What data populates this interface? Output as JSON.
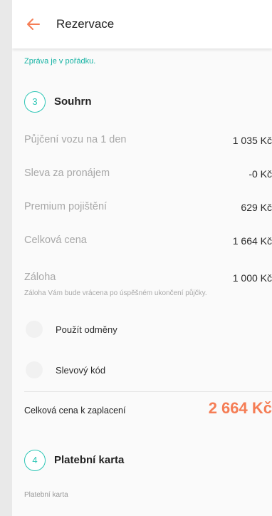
{
  "header": {
    "title": "Rezervace",
    "back_icon": "arrow-left-icon",
    "accent_color": "#f57d55"
  },
  "notice": "Zpráva je v pořádku.",
  "sections": {
    "summary": {
      "step": "3",
      "title": "Souhrn"
    },
    "payment": {
      "step": "4",
      "title": "Platební karta",
      "field_label": "Platební karta"
    }
  },
  "summary_rows": [
    {
      "label": "Půjčení vozu na 1 den",
      "value": "1 035 Kč"
    },
    {
      "label": "Sleva za pronájem",
      "value": "-0 Kč"
    },
    {
      "label": "Premium pojištění",
      "value": "629 Kč"
    },
    {
      "label": "Celková cena",
      "value": "1 664 Kč"
    },
    {
      "label": "Záloha",
      "value": "1 000 Kč",
      "note": "Záloha Vám bude vrácena po úspěšném ukončení půjčky."
    }
  ],
  "options": [
    {
      "label": "Použít odměny"
    },
    {
      "label": "Slevový kód"
    }
  ],
  "total": {
    "label": "Celková cena k zaplacení",
    "value": "2 664 Kč",
    "color": "#f57d55"
  },
  "step_color": "#2ec6b6"
}
